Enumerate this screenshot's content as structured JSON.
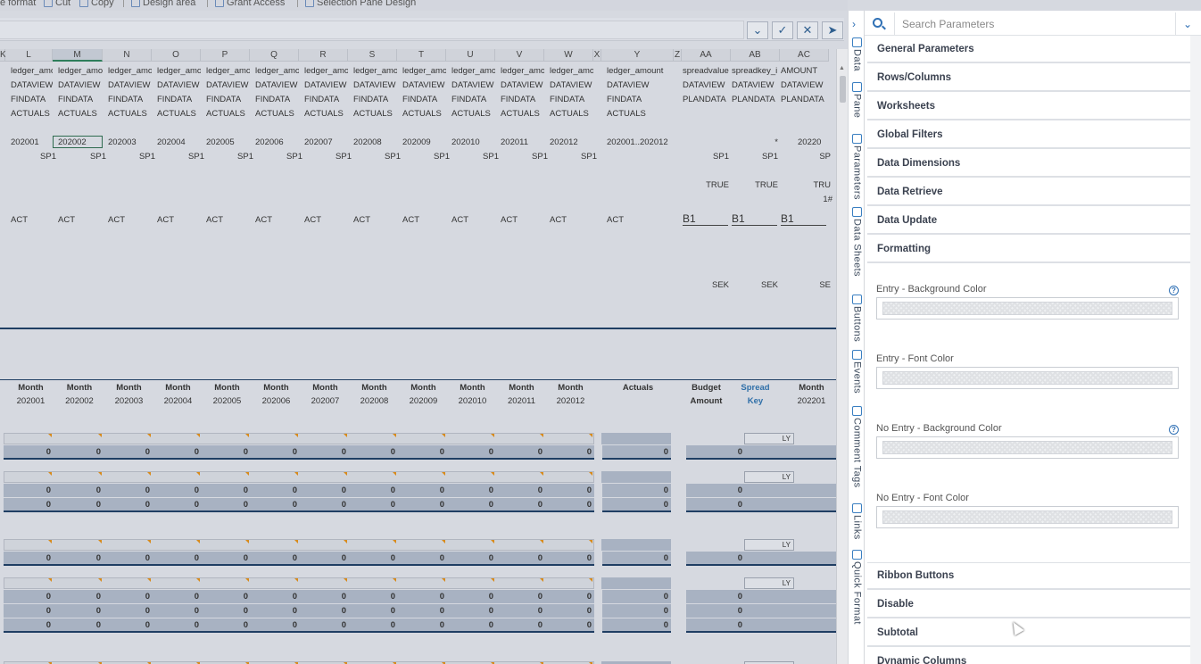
{
  "ribbon": {
    "items": [
      "e format",
      "Cut",
      "Copy",
      "Design area",
      "Grant Access",
      "Selection Pane Design"
    ]
  },
  "formula_bar": {
    "buttons": [
      "⌄",
      "✓",
      "✕",
      "➤"
    ]
  },
  "grid": {
    "columns": [
      {
        "id": "K",
        "label": "K"
      },
      {
        "id": "L",
        "label": "L"
      },
      {
        "id": "M",
        "label": "M"
      },
      {
        "id": "N",
        "label": "N"
      },
      {
        "id": "O",
        "label": "O"
      },
      {
        "id": "P",
        "label": "P"
      },
      {
        "id": "Q",
        "label": "Q"
      },
      {
        "id": "R",
        "label": "R"
      },
      {
        "id": "S",
        "label": "S"
      },
      {
        "id": "T",
        "label": "T"
      },
      {
        "id": "U",
        "label": "U"
      },
      {
        "id": "V",
        "label": "V"
      },
      {
        "id": "W",
        "label": "W"
      },
      {
        "id": "X",
        "label": "X"
      },
      {
        "id": "Y",
        "label": "Y"
      },
      {
        "id": "Z",
        "label": "Z"
      },
      {
        "id": "AA",
        "label": "AA"
      },
      {
        "id": "AB",
        "label": "AB"
      },
      {
        "id": "AC",
        "label": "AC"
      }
    ],
    "selected_column": "M",
    "row_ledger": [
      "ledger_amo",
      "ledger_amo",
      "ledger_amo",
      "ledger_amo",
      "ledger_amo",
      "ledger_amo",
      "ledger_amo",
      "ledger_amo",
      "ledger_amo",
      "ledger_amo",
      "ledger_amo",
      "ledger_amour",
      "ledger_amount"
    ],
    "row_dataview": "DATAVIEW",
    "row_findata": "FINDATA",
    "row_actuals": "ACTUALS",
    "periods": [
      "202001",
      "202002",
      "202003",
      "202004",
      "202005",
      "202006",
      "202007",
      "202008",
      "202009",
      "202010",
      "202011",
      "202012",
      "202001..202012"
    ],
    "sp1": "SP1",
    "act": "ACT",
    "right_cols": {
      "headers": [
        "spreadvalue",
        "spreadkey_i",
        "AMOUNT"
      ],
      "dataview": [
        "DATAVIEW",
        "DATAVIEW",
        "DATAVIEW"
      ],
      "plandata": [
        "PLANDATA",
        "PLANDATA",
        "PLANDATA"
      ],
      "star": "*",
      "period_partial": "20220",
      "sp1": [
        "SP1",
        "SP1",
        "SP"
      ],
      "true": [
        "TRUE",
        "TRUE",
        "TRU"
      ],
      "hash": "1#",
      "b1": [
        "B1",
        "B1",
        "B1"
      ],
      "sek": [
        "SEK",
        "SEK",
        "SE"
      ]
    },
    "report_headers": {
      "month": "Month",
      "months": [
        "202001",
        "202002",
        "202003",
        "202004",
        "202005",
        "202006",
        "202007",
        "202008",
        "202009",
        "202010",
        "202011",
        "202012"
      ],
      "actuals": "Actuals",
      "budget_1": "Budget",
      "budget_2": "Amount",
      "spread_1": "Spread",
      "spread_2": "Key",
      "last_month_1": "Month",
      "last_month_2": "202201"
    },
    "ly": "LY",
    "zero": "0"
  },
  "vtabs": [
    "Data",
    "Pane",
    "Parameters",
    "Data Sheets",
    "Buttons",
    "Events",
    "Comment Tags",
    "Links",
    "Quick Format"
  ],
  "panel": {
    "search_placeholder": "Search Parameters",
    "sections_top": [
      "General Parameters",
      "Rows/Columns",
      "Worksheets",
      "Global Filters",
      "Data Dimensions",
      "Data Retrieve",
      "Data Update",
      "Formatting"
    ],
    "formatting": [
      {
        "label": "Entry - Background Color",
        "help": true
      },
      {
        "label": "Entry - Font Color",
        "help": false
      },
      {
        "label": "No Entry - Background Color",
        "help": true
      },
      {
        "label": "No Entry - Font Color",
        "help": false
      }
    ],
    "sections_bottom": [
      "Ribbon Buttons",
      "Disable",
      "Subtotal",
      "Dynamic Columns"
    ],
    "help_glyph": "?"
  }
}
